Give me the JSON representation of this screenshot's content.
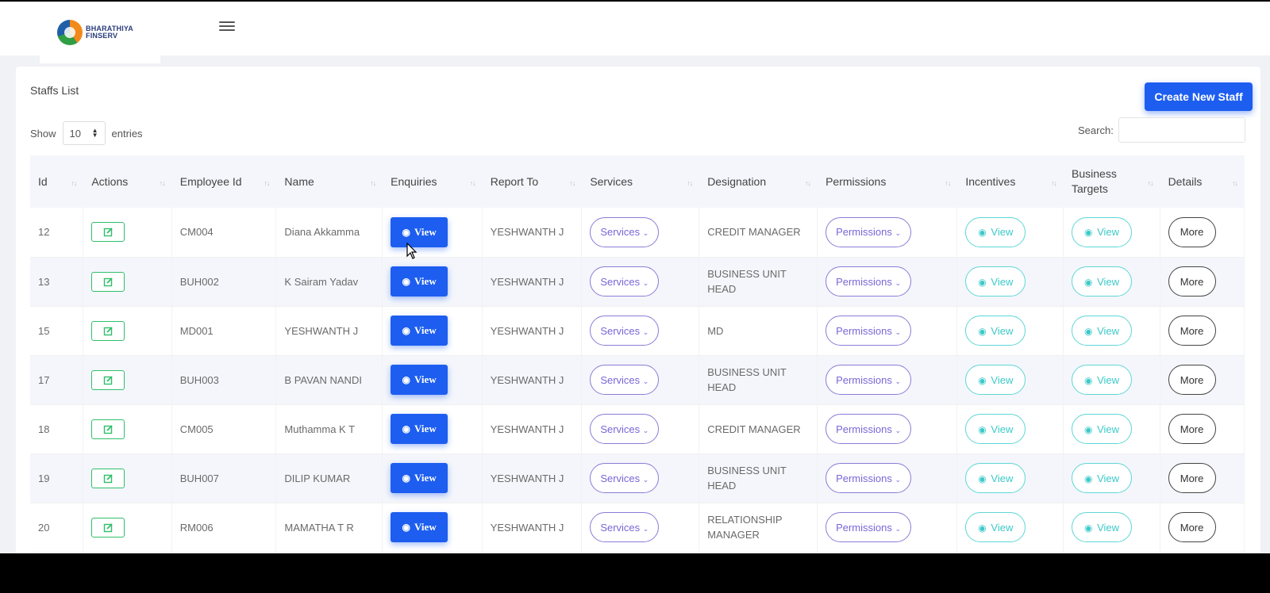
{
  "app": {
    "logo_line1": "BHARATHIYA",
    "logo_line2": "FINSERV"
  },
  "page": {
    "title": "Staffs List",
    "create_label": "Create New Staff"
  },
  "controls": {
    "show_label": "Show",
    "entries_value": "10",
    "entries_label": "entries",
    "search_label": "Search:"
  },
  "columns": [
    "Id",
    "Actions",
    "Employee Id",
    "Name",
    "Enquiries",
    "Report To",
    "Services",
    "Designation",
    "Permissions",
    "Incentives",
    "Business Targets",
    "Details"
  ],
  "labels": {
    "view": "View",
    "services": "Services",
    "permissions": "Permissions",
    "more": "More"
  },
  "rows": [
    {
      "id": "12",
      "employee_id": "CM004",
      "name": "Diana Akkamma",
      "report_to": "YESHWANTH J",
      "designation": "CREDIT MANAGER"
    },
    {
      "id": "13",
      "employee_id": "BUH002",
      "name": "K Sairam Yadav",
      "report_to": "YESHWANTH J",
      "designation": "BUSINESS UNIT HEAD"
    },
    {
      "id": "15",
      "employee_id": "MD001",
      "name": "YESHWANTH J",
      "report_to": "YESHWANTH J",
      "designation": "MD"
    },
    {
      "id": "17",
      "employee_id": "BUH003",
      "name": "B PAVAN NANDI",
      "report_to": "YESHWANTH J",
      "designation": "BUSINESS UNIT HEAD"
    },
    {
      "id": "18",
      "employee_id": "CM005",
      "name": "Muthamma K T",
      "report_to": "YESHWANTH J",
      "designation": "CREDIT MANAGER"
    },
    {
      "id": "19",
      "employee_id": "BUH007",
      "name": "DILIP KUMAR",
      "report_to": "YESHWANTH J",
      "designation": "BUSINESS UNIT HEAD"
    },
    {
      "id": "20",
      "employee_id": "RM006",
      "name": "MAMATHA T R",
      "report_to": "YESHWANTH J",
      "designation": "RELATIONSHIP MANAGER"
    }
  ],
  "icons": {
    "menu": "hamburger-icon",
    "edit": "edit-icon",
    "eye": "eye-icon",
    "chevron": "chevron-down-icon",
    "sort": "sort-icon"
  },
  "colors": {
    "primary": "#1d5ef0",
    "edit": "#2fbf6a",
    "purple": "#7a66d8",
    "cyan": "#3cc9c9"
  }
}
